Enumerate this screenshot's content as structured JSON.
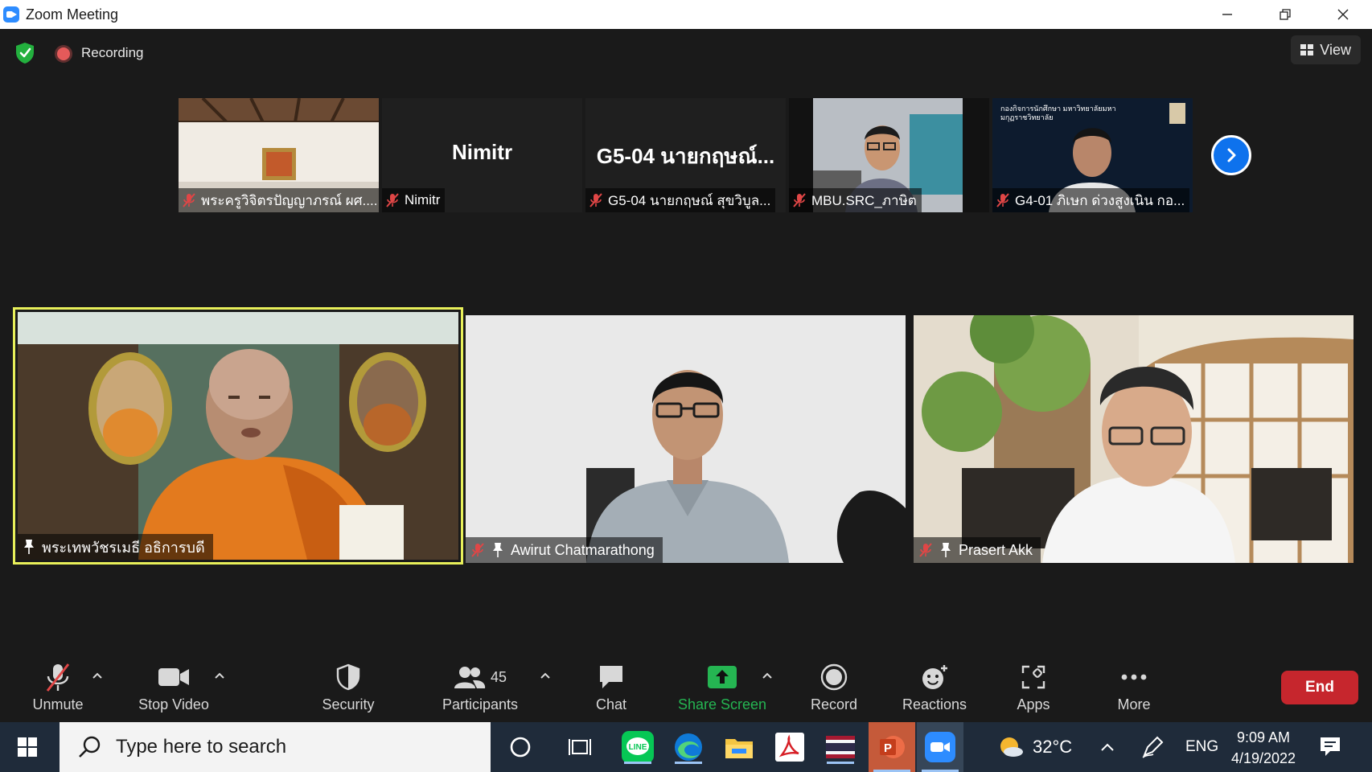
{
  "window": {
    "title": "Zoom Meeting"
  },
  "topbar": {
    "recording_label": "Recording",
    "view_label": "View"
  },
  "thumbnails": [
    {
      "label": "พระครูวิจิตรปัญญาภรณ์ ผศ...."
    },
    {
      "big_name": "Nimitr",
      "label": "Nimitr"
    },
    {
      "big_name": "G5-04 นายกฤษณ์...",
      "label": "G5-04 นายกฤษณ์ สุขวิบูล..."
    },
    {
      "label": "MBU.SRC_ภาษิต"
    },
    {
      "label": "G4-01 ภิเษก ด่วงสูงเนิน กอ...",
      "banner": "กองกิจการนักศึกษา มหาวิทยาลัยมหามกุฏราชวิทยาลัย"
    }
  ],
  "tiles": [
    {
      "name": "พระเทพวัชรเมธี อธิการบดี",
      "active": true
    },
    {
      "name": "Awirut Chatmarathong"
    },
    {
      "name": "Prasert Akk"
    }
  ],
  "toolbar": {
    "unmute": "Unmute",
    "stop_video": "Stop Video",
    "security": "Security",
    "participants": "Participants",
    "participants_count": "45",
    "chat": "Chat",
    "share_screen": "Share Screen",
    "record": "Record",
    "reactions": "Reactions",
    "apps": "Apps",
    "more": "More",
    "end": "End"
  },
  "taskbar": {
    "search_placeholder": "Type here to search",
    "weather": "32°C",
    "language": "ENG",
    "time": "9:09 AM",
    "date": "4/19/2022"
  },
  "colors": {
    "zoom_blue": "#2d8cff",
    "end_red": "#c6262d",
    "share_green": "#25b552",
    "active_speaker": "#e8f05a",
    "muted_red": "#e04646"
  }
}
